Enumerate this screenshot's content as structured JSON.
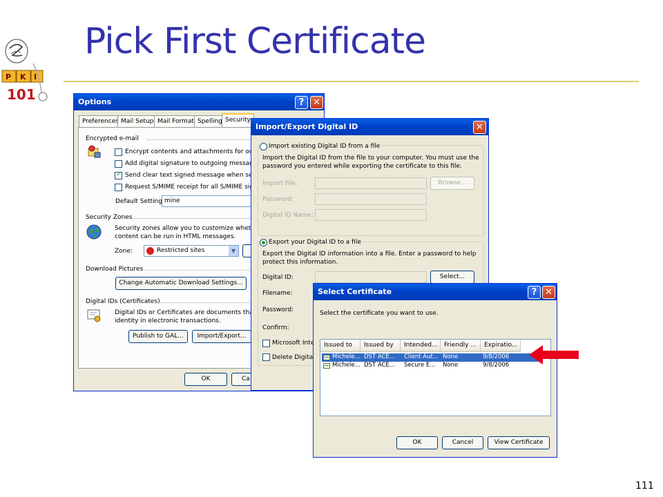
{
  "slide": {
    "title": "Pick First Certificate",
    "number": "111"
  },
  "options_window": {
    "title": "Options",
    "tabs": [
      "Preferences",
      "Mail Setup",
      "Mail Format",
      "Spelling",
      "Security"
    ],
    "encrypted_group": "Encrypted e-mail",
    "checkboxes": [
      {
        "label": "Encrypt contents and attachments for outgoin",
        "checked": false
      },
      {
        "label": "Add digital signature to outgoing messages",
        "checked": false
      },
      {
        "label": "Send clear text signed message when sendin",
        "checked": true
      },
      {
        "label": "Request S/MIME receipt for all S/MIME signe",
        "checked": false
      }
    ],
    "default_setting_label": "Default Setting:",
    "default_setting_value": "mine",
    "security_zones_group": "Security Zones",
    "security_zones_text_1": "Security zones allow you to customize whether s",
    "security_zones_text_2": "content can be run in HTML messages.",
    "zone_label": "Zone:",
    "zone_value": "Restricted sites",
    "download_pictures_group": "Download Pictures",
    "change_download_button": "Change Automatic Download Settings...",
    "digital_ids_group": "Digital IDs (Certificates)",
    "digital_ids_text_1": "Digital IDs or Certificates are documents that allo",
    "digital_ids_text_2": "identity in electronic transactions.",
    "publish_button": "Publish to GAL...",
    "import_export_button": "Import/Export...",
    "ok_button": "OK",
    "cancel_button": "Ca"
  },
  "import_export_window": {
    "title": "Import/Export Digital ID",
    "import_radio": "Import existing Digital ID from a file",
    "import_desc_1": "Import the Digital ID from the file to your computer. You must use the",
    "import_desc_2": "password you entered while exporting the certificate to this file.",
    "import_file_label": "Import File:",
    "browse_button": "Browse...",
    "password_label": "Password:",
    "digital_id_name_label": "Digital ID Name:",
    "export_radio": "Export your Digital ID to a file",
    "export_desc_1": "Export the Digital ID information into a file. Enter a password to help",
    "export_desc_2": "protect this information.",
    "digital_id_label": "Digital ID:",
    "select_button": "Select...",
    "filename_label": "Filename:",
    "export_password_label": "Password:",
    "confirm_label": "Confirm:",
    "microsoft_checkbox": "Microsoft Intern",
    "delete_checkbox": "Delete Digital I"
  },
  "select_certificate_window": {
    "title": "Select Certificate",
    "instruction": "Select the certificate you want to use.",
    "columns": [
      "Issued to",
      "Issued by",
      "Intended...",
      "Friendly ...",
      "Expiratio..."
    ],
    "rows": [
      {
        "issued_to": "Michele...",
        "issued_by": "DST ACE...",
        "intended": "Client Aut...",
        "friendly": "None",
        "expiration": "9/8/2006",
        "selected": true
      },
      {
        "issued_to": "Michele...",
        "issued_by": "DST ACE...",
        "intended": "Secure E...",
        "friendly": "None",
        "expiration": "9/8/2006",
        "selected": false
      }
    ],
    "ok_button": "OK",
    "cancel_button": "Cancel",
    "view_certificate_button": "View Certificate"
  },
  "colors": {
    "title_color": "#3333aa",
    "xp_titlebar": "#0043c8",
    "selection": "#316ac5",
    "arrow": "#e8001c"
  }
}
